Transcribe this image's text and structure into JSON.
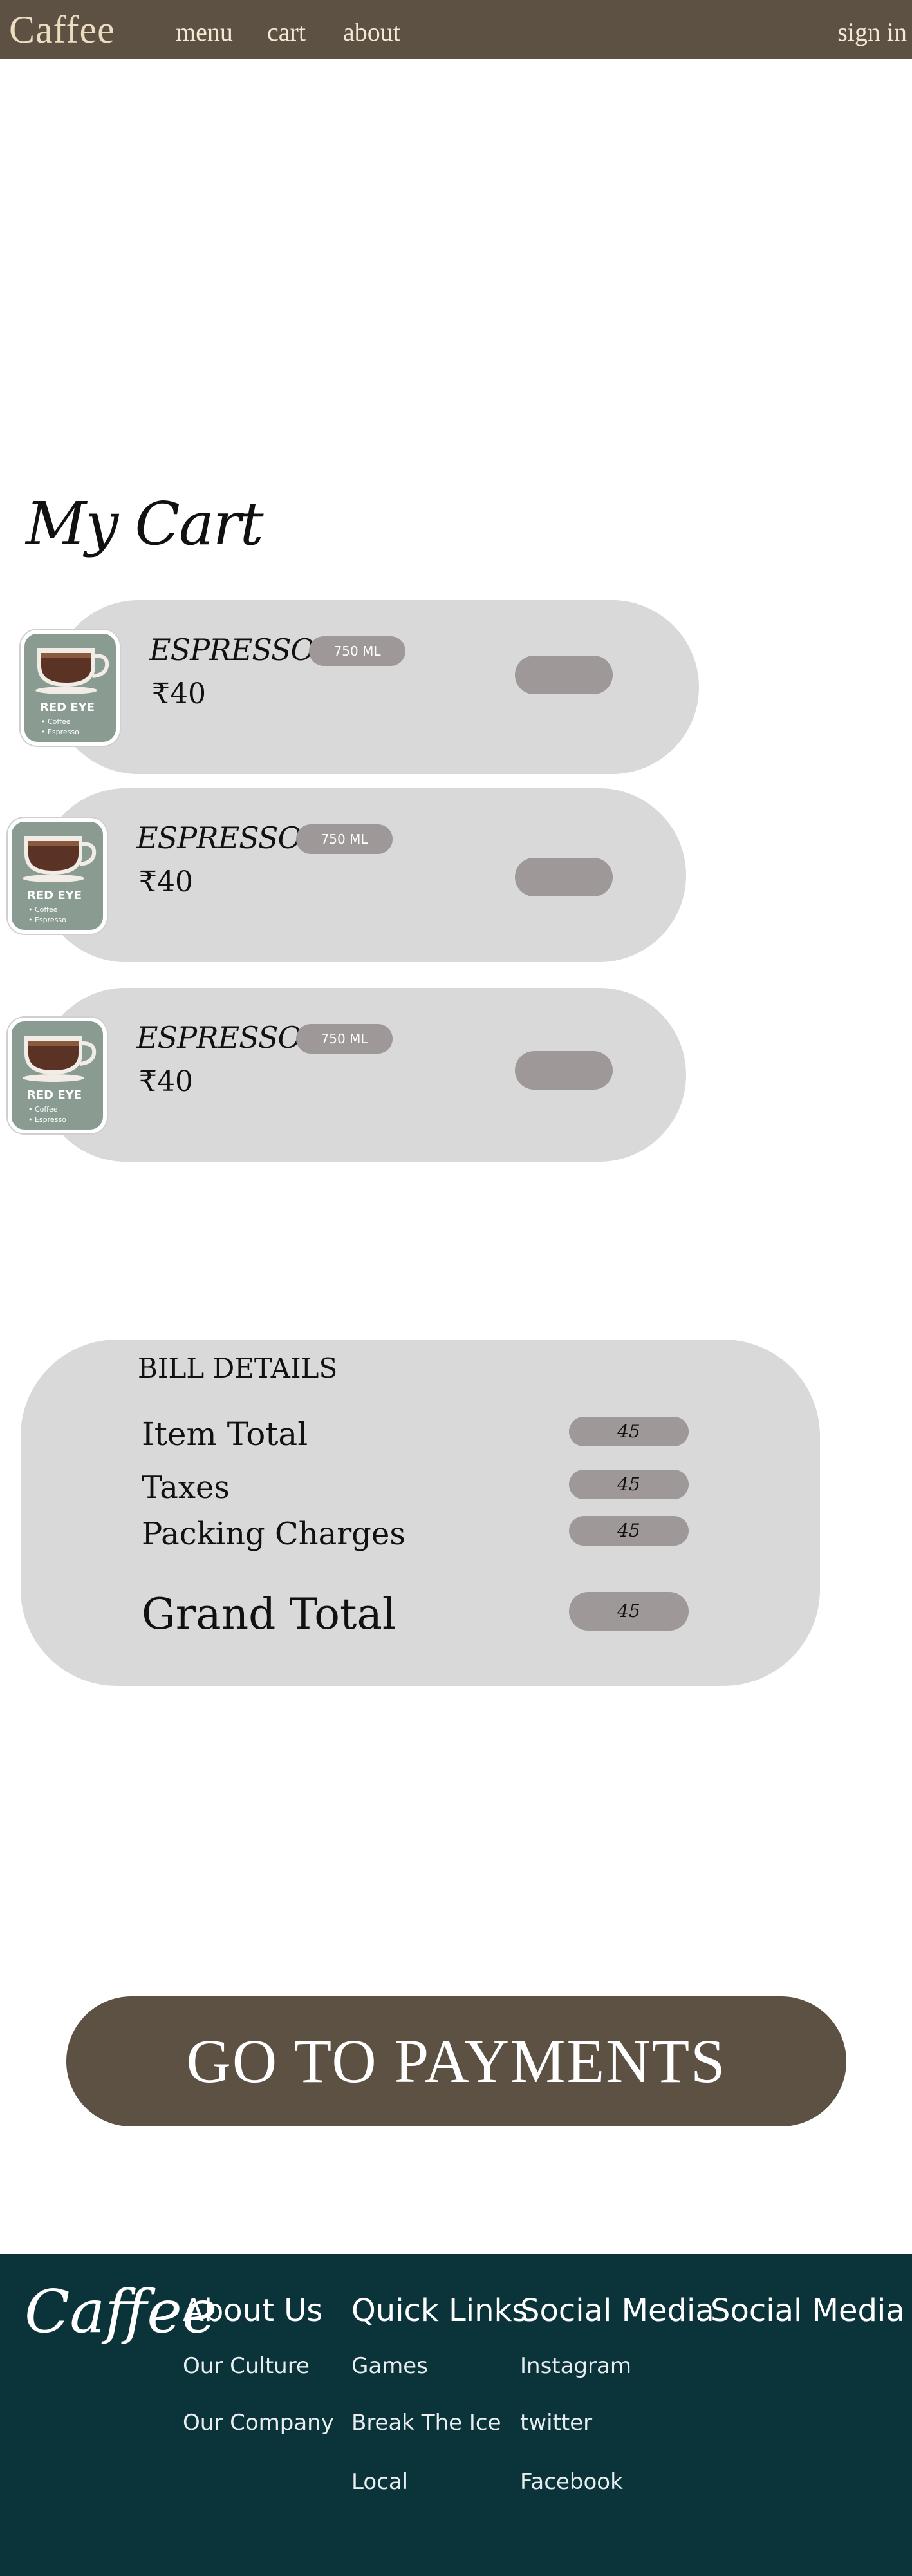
{
  "nav": {
    "brand": "Caffee",
    "menu": "menu",
    "cart": "cart",
    "about": "about",
    "signin": "sign in",
    "bg_color": "#5c5142"
  },
  "page_title": "My Cart",
  "cart_items": [
    {
      "thumb_name": "RED EYE",
      "thumb_sub1": "• Coffee",
      "thumb_sub2": "• Espresso",
      "name": "ESPRESSO",
      "size": "750 ML",
      "price": "₹40"
    },
    {
      "thumb_name": "RED EYE",
      "thumb_sub1": "• Coffee",
      "thumb_sub2": "• Espresso",
      "name": "ESPRESSO",
      "size": "750 ML",
      "price": "₹40"
    },
    {
      "thumb_name": "RED EYE",
      "thumb_sub1": "• Coffee",
      "thumb_sub2": "• Espresso",
      "name": "ESPRESSO",
      "size": "750 ML",
      "price": "₹40"
    }
  ],
  "bill": {
    "heading": "BILL DETAILS",
    "item_total_label": "Item Total",
    "item_total_value": "45",
    "taxes_label": "Taxes",
    "taxes_value": "45",
    "packing_label": "Packing Charges",
    "packing_value": "45",
    "grand_total_label": "Grand Total",
    "grand_total_value": "45"
  },
  "pay_button": "GO TO PAYMENTS",
  "footer": {
    "brand": "Caffee",
    "about_heading": "About Us",
    "about_links": [
      "Our Culture",
      "Our Company"
    ],
    "quick_heading": "Quick Links",
    "quick_links": [
      "Games",
      "Break The Ice",
      "Local"
    ],
    "social_heading": "Social Media",
    "social_links": [
      "Instagram",
      "twitter",
      "Facebook"
    ],
    "social_heading_2": "Social Media",
    "bg_color": "#0b333a"
  },
  "icons": {
    "coffee_cup": "coffee-cup-icon"
  }
}
